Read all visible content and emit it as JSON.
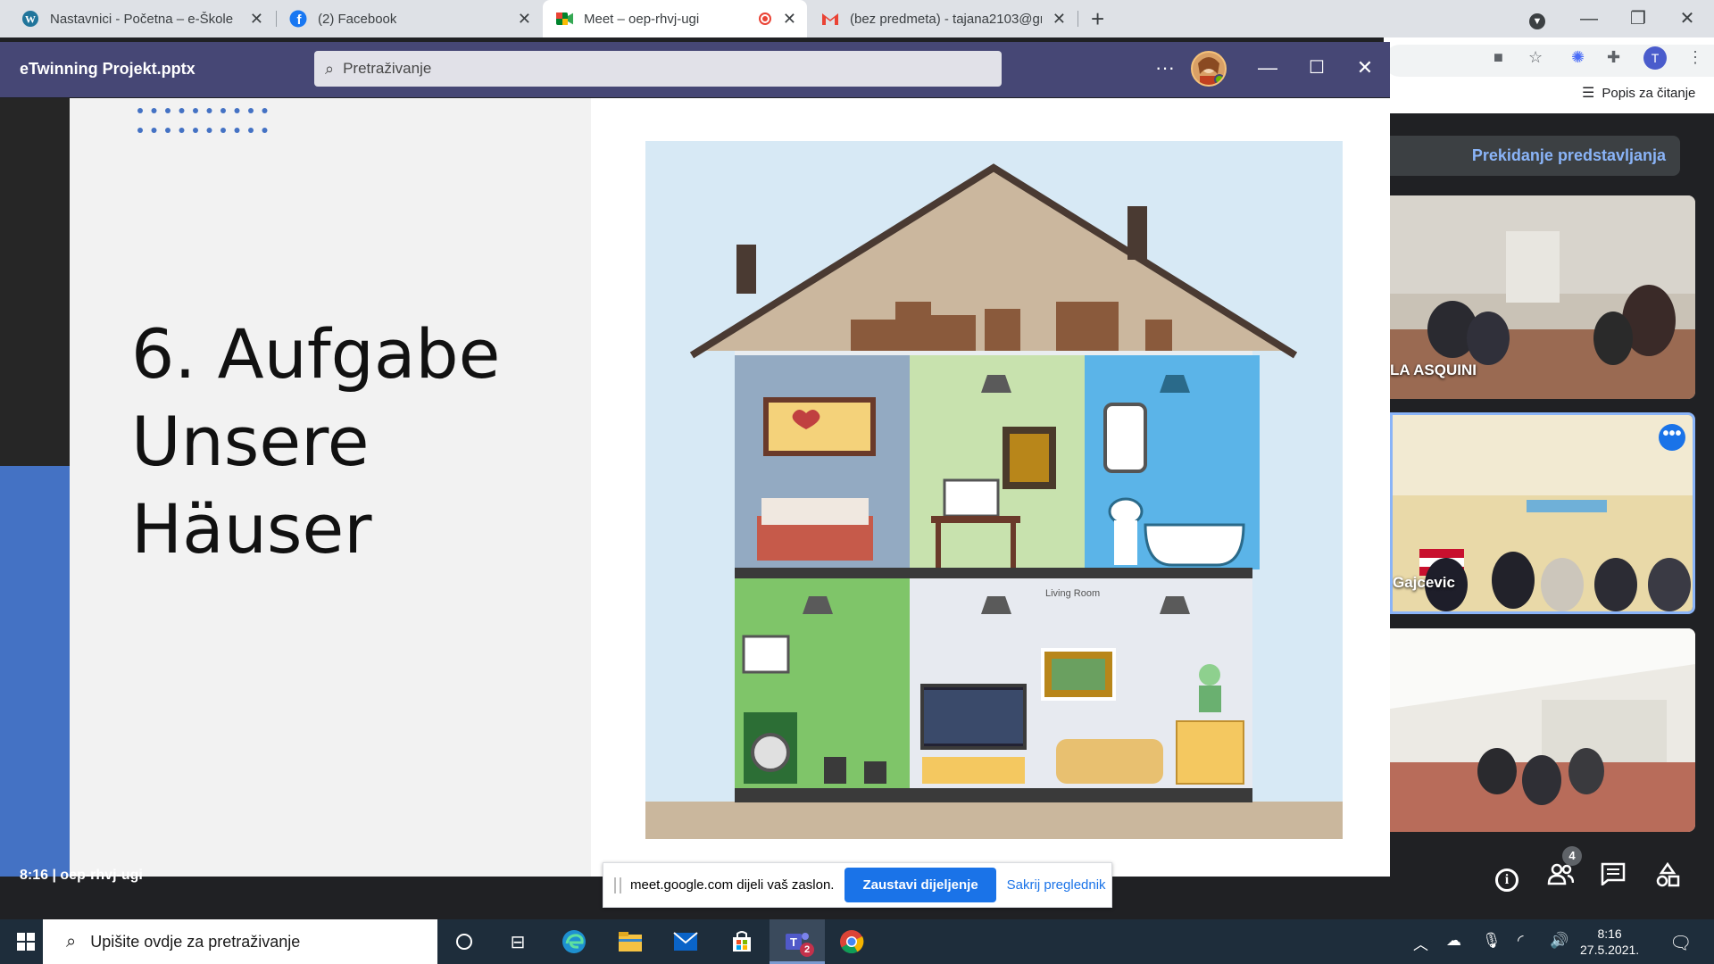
{
  "browser": {
    "tabs": [
      {
        "label": "Nastavnici - Početna – e-Škole",
        "icon": "wordpress-icon"
      },
      {
        "label": "(2) Facebook",
        "icon": "facebook-icon"
      },
      {
        "label": "Meet – oep-rhvj-ugi",
        "icon": "meet-icon",
        "active": true
      },
      {
        "label": "(bez predmeta) - tajana2103@gm",
        "icon": "gmail-icon"
      }
    ],
    "reading_list": "Popis za čitanje",
    "profile_initial": "T"
  },
  "ppt": {
    "title": "eTwinning Projekt.pptx",
    "search_placeholder": "Pretraživanje",
    "slide": {
      "title_lines": [
        "6. Aufgabe",
        "Unsere",
        "Häuser"
      ],
      "image_labels": {
        "living_room": "Living Room"
      }
    }
  },
  "meet": {
    "stop_presenting": "Prekidanje predstavljanja",
    "tiles": [
      {
        "name": "LA ASQUINI"
      },
      {
        "name": "Gajcevic"
      },
      {
        "name": ""
      }
    ],
    "people_count": "4",
    "meeting_info": "8:16 | oep-rhvj-ugi"
  },
  "sharebar": {
    "message": "meet.google.com dijeli vaš zaslon.",
    "stop_label": "Zaustavi dijeljenje",
    "hide_label": "Sakrij preglednik"
  },
  "taskbar": {
    "search_placeholder": "Upišite ovdje za pretraživanje",
    "time": "8:16",
    "date": "27.5.2021.",
    "teams_badge": "2"
  },
  "colors": {
    "ppt_bar": "#464775",
    "slide_accent": "#4472c4",
    "meet_blue": "#1a73e8"
  }
}
